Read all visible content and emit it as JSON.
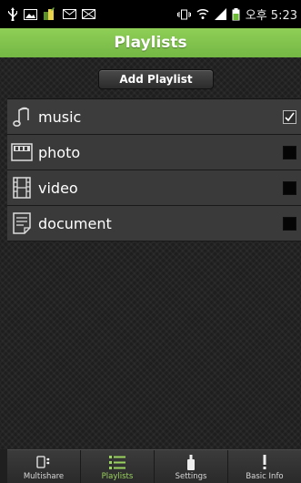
{
  "status_bar": {
    "time": "오후 5:23"
  },
  "header": {
    "title": "Playlists"
  },
  "main": {
    "add_button_label": "Add Playlist",
    "playlists": [
      {
        "label": "music",
        "icon": "music-note-icon",
        "checked": true
      },
      {
        "label": "photo",
        "icon": "photo-icon",
        "checked": false
      },
      {
        "label": "video",
        "icon": "film-icon",
        "checked": false
      },
      {
        "label": "document",
        "icon": "document-icon",
        "checked": false
      }
    ]
  },
  "tabs": [
    {
      "label": "Multishare",
      "icon": "multishare-icon",
      "active": false
    },
    {
      "label": "Playlists",
      "icon": "list-icon",
      "active": true
    },
    {
      "label": "Settings",
      "icon": "settings-icon",
      "active": false
    },
    {
      "label": "Basic Info",
      "icon": "info-icon",
      "active": false
    }
  ],
  "colors": {
    "accent": "#7fc24b",
    "active_tab_text": "#9bd35f",
    "list_item_bg": "#3a3a3a",
    "status_bar_bg": "#000000"
  }
}
